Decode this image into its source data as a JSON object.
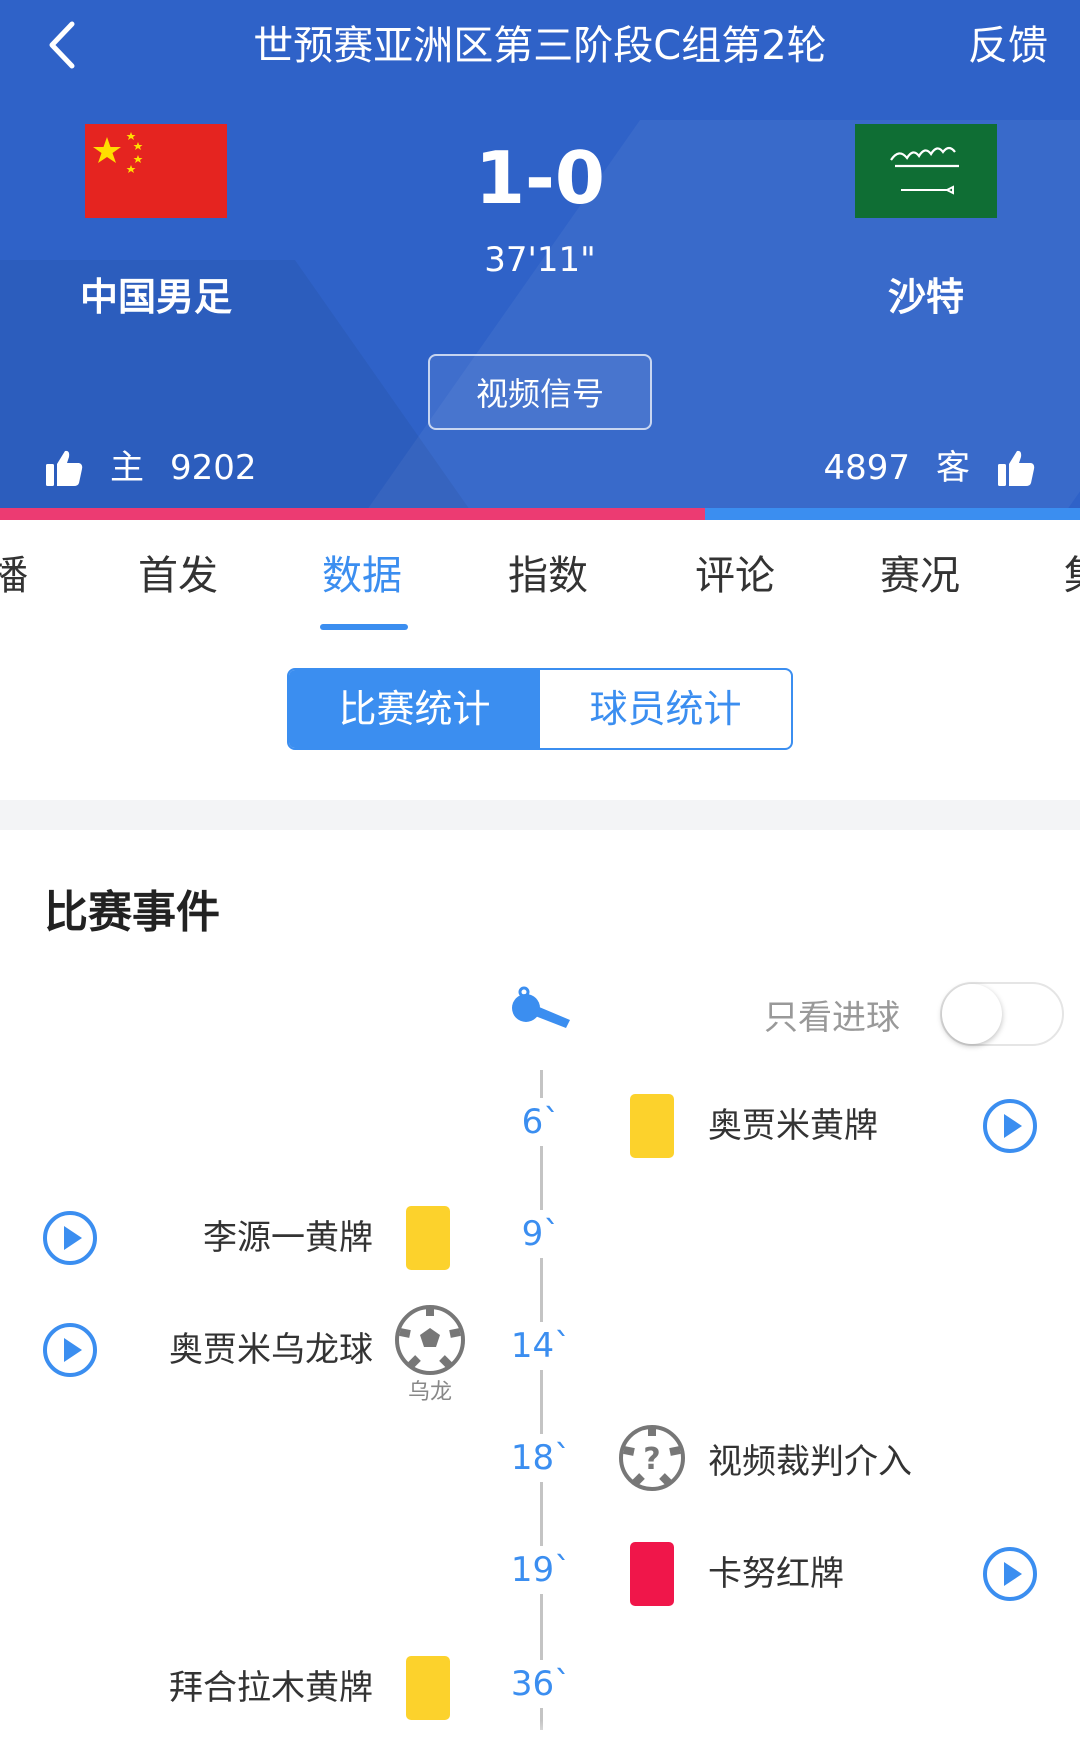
{
  "header": {
    "title": "世预赛亚洲区第三阶段C组第2轮",
    "feedback": "反馈",
    "home_team": "中国男足",
    "away_team": "沙特",
    "score": "1-0",
    "clock": "37'11\"",
    "video_button": "视频信号",
    "home_label": "主",
    "home_likes": "9202",
    "away_label": "客",
    "away_likes": "4897",
    "home_like_share": 0.653
  },
  "colors": {
    "header_bg": "#2f62c8",
    "accent": "#3b8ef0",
    "home_bar": "#ec3b72",
    "away_bar": "#3b8ef0",
    "yellow_card": "#fcd22c",
    "red_card": "#f0164a"
  },
  "tabs": [
    "播",
    "首发",
    "数据",
    "指数",
    "评论",
    "赛况",
    "集"
  ],
  "active_tab": "数据",
  "segment": {
    "left": "比赛统计",
    "right": "球员统计",
    "active": "比赛统计"
  },
  "events_section": {
    "title": "比赛事件",
    "goal_only_label": "只看进球",
    "goal_only_on": false,
    "events": [
      {
        "minute": "6`",
        "side": "away",
        "type": "yellow-card",
        "text": "奥贾米黄牌",
        "video": true
      },
      {
        "minute": "9`",
        "side": "home",
        "type": "yellow-card",
        "text": "李源一黄牌",
        "video": true
      },
      {
        "minute": "14`",
        "side": "home",
        "type": "own-goal",
        "text": "奥贾米乌龙球",
        "tag": "乌龙",
        "video": true
      },
      {
        "minute": "18`",
        "side": "away",
        "type": "var",
        "text": "视频裁判介入",
        "video": false
      },
      {
        "minute": "19`",
        "side": "away",
        "type": "red-card",
        "text": "卡努红牌",
        "video": true
      },
      {
        "minute": "36`",
        "side": "home",
        "type": "yellow-card",
        "text": "拜合拉木黄牌",
        "video": false
      }
    ]
  }
}
